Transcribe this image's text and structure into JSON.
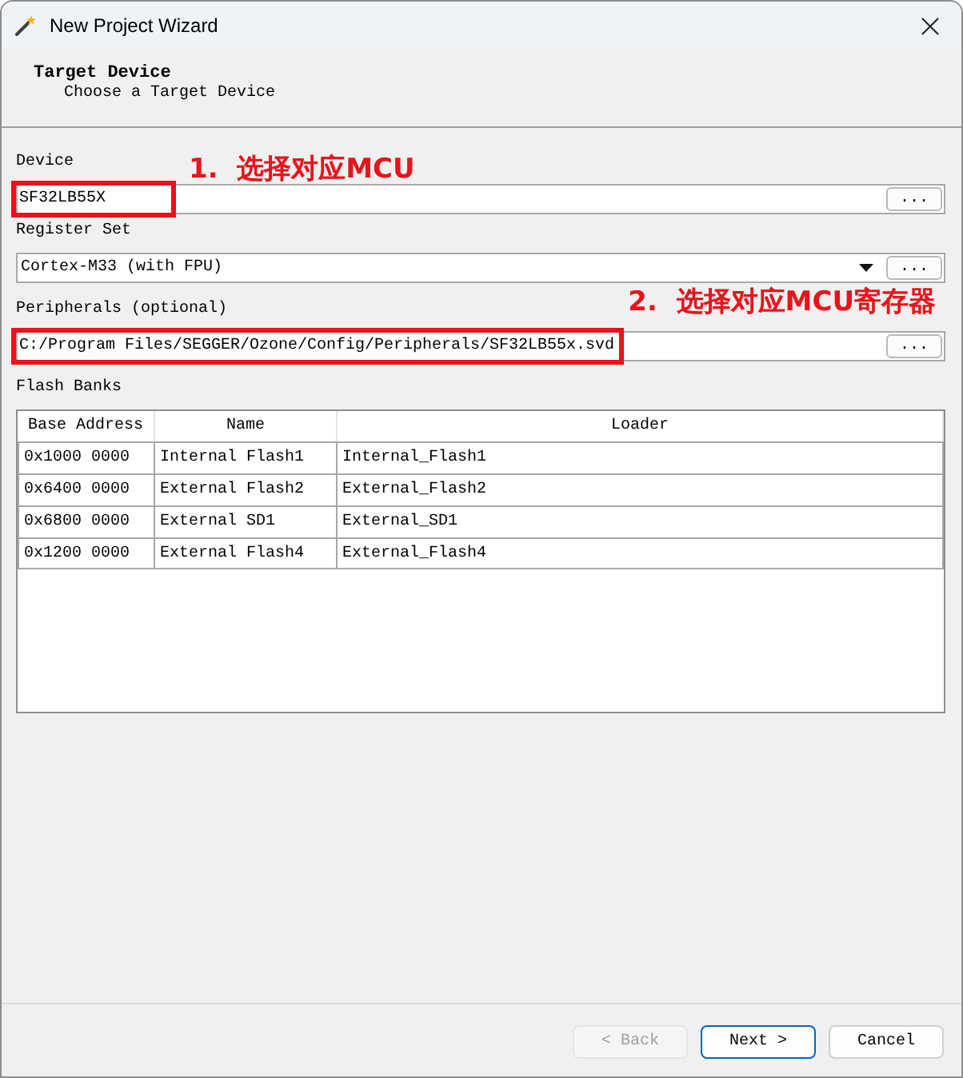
{
  "window": {
    "title": "New Project Wizard"
  },
  "header": {
    "title": "Target Device",
    "subtitle": "Choose a Target Device"
  },
  "fields": [
    {
      "kind": "text",
      "label": "Device",
      "value": "SF32LB55X",
      "button": "...",
      "highlighted": true,
      "annotation": "1.  选择对应MCU"
    },
    {
      "kind": "dropdown",
      "label": "Register Set",
      "value": "Cortex-M33 (with FPU)",
      "button": "..."
    },
    {
      "kind": "text",
      "label": "Peripherals (optional)",
      "value": "C:/Program Files/SEGGER/Ozone/Config/Peripherals/SF32LB55x.svd",
      "button": "...",
      "highlighted": true,
      "annotation": "2.  选择对应MCU寄存器"
    }
  ],
  "flash_banks": {
    "label": "Flash Banks",
    "columns": [
      "Base Address",
      "Name",
      "Loader"
    ],
    "rows": [
      [
        "0x1000 0000",
        "Internal Flash1",
        "Internal_Flash1"
      ],
      [
        "0x6400 0000",
        "External Flash2",
        "External_Flash2"
      ],
      [
        "0x6800 0000",
        "External SD1",
        "External_SD1"
      ],
      [
        "0x1200 0000",
        "External Flash4",
        "External_Flash4"
      ]
    ]
  },
  "buttons": [
    {
      "label": "< Back",
      "disabled": true,
      "default": false
    },
    {
      "label": "Next >",
      "disabled": false,
      "default": true
    },
    {
      "label": "Cancel",
      "disabled": false,
      "default": false
    }
  ]
}
